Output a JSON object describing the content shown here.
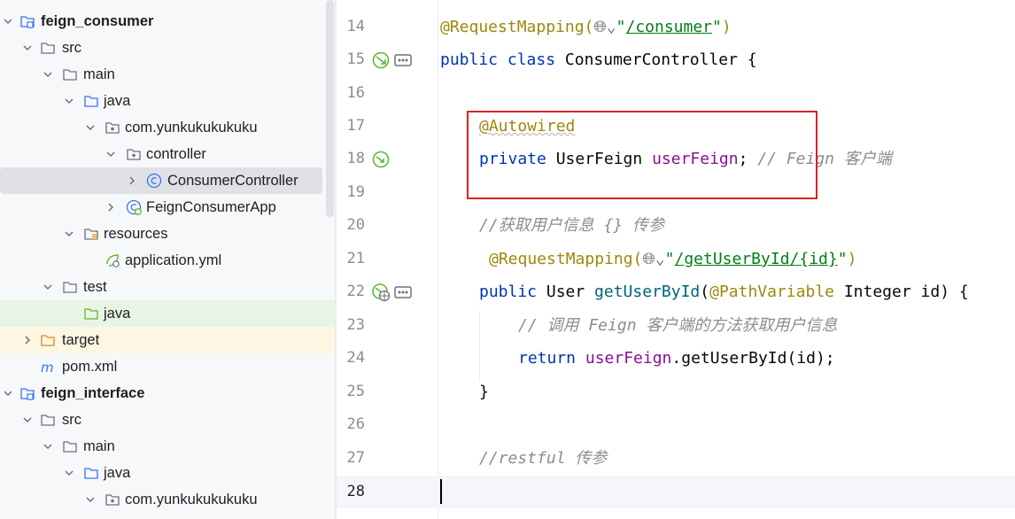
{
  "tree": {
    "rows": [
      {
        "label": "feign_consumer",
        "bold": true
      },
      {
        "label": "src"
      },
      {
        "label": "main"
      },
      {
        "label": "java"
      },
      {
        "label": "com.yunkukukukuku"
      },
      {
        "label": "controller"
      },
      {
        "label": "ConsumerController"
      },
      {
        "label": "FeignConsumerApp"
      },
      {
        "label": "resources"
      },
      {
        "label": "application.yml"
      },
      {
        "label": "test"
      },
      {
        "label": "java"
      },
      {
        "label": "target"
      },
      {
        "label": "pom.xml"
      },
      {
        "label": "feign_interface",
        "bold": true
      },
      {
        "label": "src"
      },
      {
        "label": "main"
      },
      {
        "label": "java"
      },
      {
        "label": "com.yunkukukukuku"
      }
    ]
  },
  "editor": {
    "line_numbers": [
      "14",
      "15",
      "16",
      "17",
      "18",
      "19",
      "20",
      "21",
      "22",
      "23",
      "24",
      "25",
      "26",
      "27",
      "28"
    ],
    "current_line": "28",
    "code": {
      "l14_ann": "@RequestMapping(",
      "l14_str_q1": "\"",
      "l14_url": "/consumer",
      "l14_str_q2": "\"",
      "l14_end": ")",
      "l15_kw": "public class ",
      "l15_rest": "ConsumerController {",
      "l17_ann": "@Autowired",
      "l18_kw": "private ",
      "l18_type": "UserFeign ",
      "l18_fld": "userFeign",
      "l18_semi": "; ",
      "l18_cmt": "// Feign 客户端",
      "l20_cmt": "//获取用户信息 {} 传参",
      "l21_ann": "@RequestMapping(",
      "l21_str_q1": "\"",
      "l21_url": "/getUserById/{id}",
      "l21_str_q2": "\"",
      "l21_end": ")",
      "l22_kw": "public ",
      "l22_type": "User ",
      "l22_mth": "getUserById",
      "l22_p1": "(",
      "l22_ann": "@PathVariable",
      "l22_rest": " Integer id) {",
      "l23_cmt": "// 调用 Feign 客户端的方法获取用户信息",
      "l24_kw": "return ",
      "l24_fld": "userFeign",
      "l24_rest": ".getUserById(id);",
      "l25": "}",
      "l27_cmt": "//restful 传参"
    }
  },
  "colors": {
    "keyword": "#0033b3",
    "annotation": "#9e880d",
    "string": "#067d17",
    "field": "#871094",
    "method": "#00627a",
    "comment": "#8c8c8c",
    "highlight_box": "#e02020"
  }
}
